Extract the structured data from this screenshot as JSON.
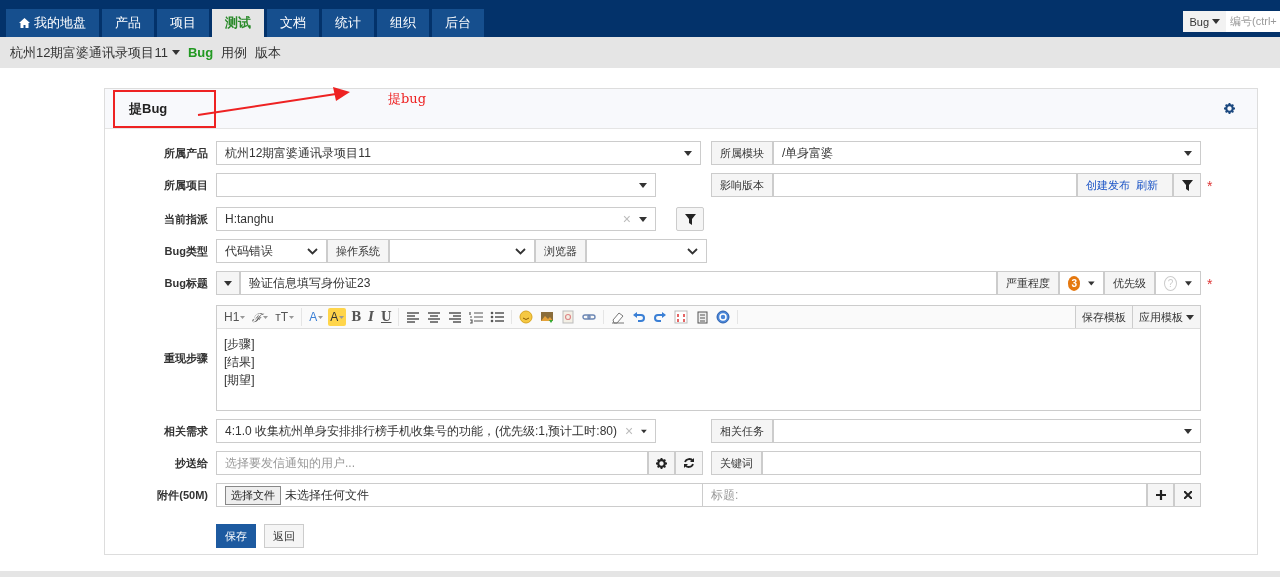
{
  "navbar": {
    "tabs": [
      {
        "label": "我的地盘",
        "kind": "icon",
        "selected": false
      },
      {
        "label": "产品",
        "kind": "plain",
        "selected": false
      },
      {
        "label": "项目",
        "kind": "plain",
        "selected": false
      },
      {
        "label": "测试",
        "kind": "plain",
        "selected": true
      },
      {
        "label": "文档",
        "kind": "plain",
        "selected": false
      },
      {
        "label": "统计",
        "kind": "plain",
        "selected": false
      },
      {
        "label": "组织",
        "kind": "plain",
        "selected": false
      },
      {
        "label": "后台",
        "kind": "plain",
        "selected": false
      }
    ],
    "search": {
      "type_button": "Bug",
      "placeholder": "编号(ctrl+"
    }
  },
  "subnav": {
    "product": "杭州12期富婆通讯录项目11",
    "links": [
      {
        "label": "Bug",
        "selected": true
      },
      {
        "label": "用例",
        "selected": false
      },
      {
        "label": "版本",
        "selected": false
      }
    ]
  },
  "panel": {
    "title": "提Bug"
  },
  "annotation": {
    "text": "提bug"
  },
  "form": {
    "product": {
      "label": "所属产品",
      "value": "杭州12期富婆通讯录项目11"
    },
    "module": {
      "label": "所属模块",
      "value": "/单身富婆"
    },
    "project": {
      "label": "所属项目"
    },
    "build": {
      "label": "影响版本",
      "links": [
        "创建发布",
        "刷新"
      ],
      "required_mark": "*"
    },
    "assigned": {
      "label": "当前指派",
      "value": "H:tanghu",
      "clear": "×"
    },
    "type_row": {
      "label": "Bug类型",
      "type_value": "代码错误",
      "os_label": "操作系统",
      "browser_label": "浏览器"
    },
    "title": {
      "label": "Bug标题",
      "value": "验证信息填写身份证23",
      "severity_label": "严重程度",
      "severity": "3",
      "priority_label": "优先级",
      "priority": "?",
      "required_mark": "*"
    },
    "steps": {
      "label": "重现步骤",
      "toolbar": [
        [
          {
            "kind": "text",
            "label": "H1",
            "caret": true
          },
          {
            "kind": "script",
            "label": "ℱ",
            "caret": true
          },
          {
            "kind": "text",
            "label": "ᴛT",
            "caret": true
          }
        ],
        [
          {
            "kind": "fontcolor",
            "label": "A",
            "caret": true
          },
          {
            "kind": "highlight",
            "label": "A",
            "caret": true
          },
          {
            "kind": "bold",
            "label": "B",
            "caret": false
          },
          {
            "kind": "italic",
            "label": "I",
            "caret": false
          },
          {
            "kind": "underline",
            "label": "U",
            "caret": false
          }
        ],
        [
          {
            "kind": "alignleft"
          },
          {
            "kind": "aligncenter"
          },
          {
            "kind": "alignright"
          },
          {
            "kind": "ol"
          },
          {
            "kind": "ul"
          }
        ],
        [
          {
            "kind": "emoji"
          },
          {
            "kind": "image"
          },
          {
            "kind": "code"
          },
          {
            "kind": "link"
          }
        ],
        [
          {
            "kind": "eraser"
          },
          {
            "kind": "undo"
          },
          {
            "kind": "redo"
          },
          {
            "kind": "table"
          },
          {
            "kind": "paste"
          },
          {
            "kind": "help"
          }
        ]
      ],
      "template_buttons": [
        {
          "label": "保存模板",
          "caret": false
        },
        {
          "label": "应用模板",
          "caret": true
        }
      ],
      "lines": [
        "[步骤]",
        "[结果]",
        "[期望]"
      ]
    },
    "story": {
      "label": "相关需求",
      "value": "4:1.0 收集杭州单身安排排行榜手机收集号的功能，(优先级:1,预计工时:80)",
      "clear": "×"
    },
    "task": {
      "label": "相关任务"
    },
    "mailto": {
      "label": "抄送给",
      "placeholder": "选择要发信通知的用户..."
    },
    "keywords": {
      "label": "关键词"
    },
    "files": {
      "label": "附件(50M)",
      "choose_button": "选择文件",
      "no_file": "未选择任何文件",
      "title_placeholder": "标题:"
    },
    "actions": [
      {
        "label": "保存",
        "kind": "primary"
      },
      {
        "label": "返回",
        "kind": "default"
      }
    ]
  }
}
